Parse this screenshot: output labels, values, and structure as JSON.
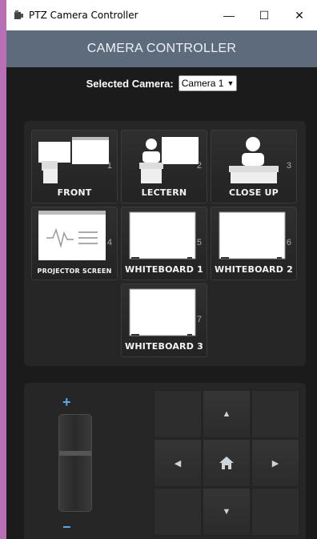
{
  "window": {
    "title": "PTZ Camera Controller",
    "minimize_glyph": "—",
    "maximize_glyph": "☐",
    "close_glyph": "✕"
  },
  "header": {
    "title": "CAMERA CONTROLLER"
  },
  "camera": {
    "label": "Selected Camera:",
    "selected": "Camera 1"
  },
  "presets": [
    {
      "number": "1",
      "label": "FRONT",
      "icon": "front-room-icon"
    },
    {
      "number": "2",
      "label": "LECTERN",
      "icon": "lectern-icon"
    },
    {
      "number": "3",
      "label": "CLOSE UP",
      "icon": "close-up-icon"
    },
    {
      "number": "4",
      "label": "PROJECTOR SCREEN",
      "icon": "projector-screen-icon"
    },
    {
      "number": "5",
      "label": "WHITEBOARD 1",
      "icon": "whiteboard-icon"
    },
    {
      "number": "6",
      "label": "WHITEBOARD 2",
      "icon": "whiteboard-icon"
    },
    {
      "number": "7",
      "label": "WHITEBOARD 3",
      "icon": "whiteboard-icon"
    }
  ],
  "zoom": {
    "plus": "+",
    "minus": "−"
  },
  "pad": {
    "up": "▲",
    "down": "▼",
    "left": "◀",
    "right": "▶"
  },
  "colors": {
    "header": "#5e6b7c",
    "background": "#1b1b1b",
    "panel": "#262626",
    "zoom_accent": "#5ba8e6"
  }
}
